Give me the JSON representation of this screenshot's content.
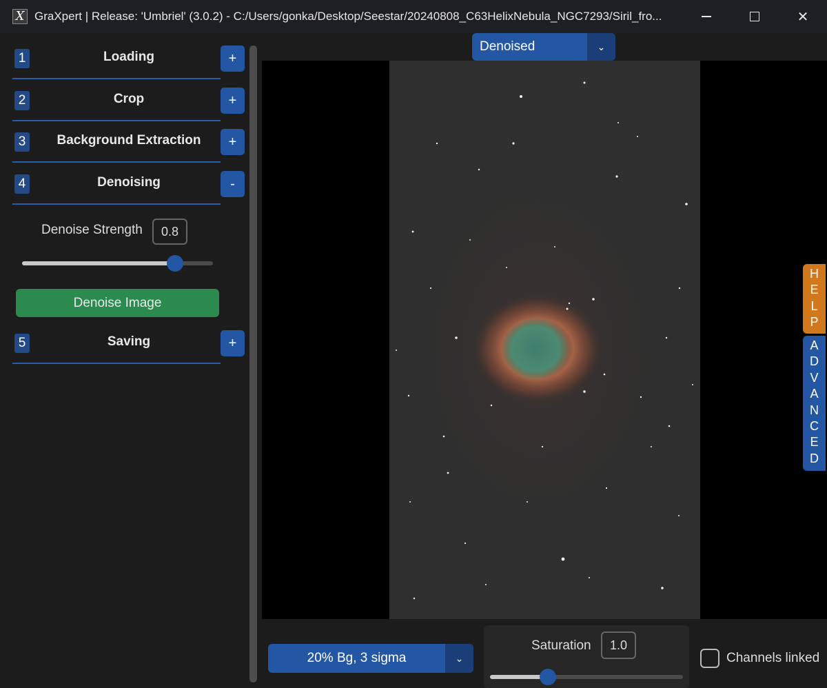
{
  "window": {
    "title": "GraXpert | Release: 'Umbriel' (3.0.2) - C:/Users/gonka/Desktop/Seestar/20240808_C63HelixNebula_NGC7293/Siril_fro...",
    "app_icon_glyph": "X",
    "minimize_icon": "minimize-icon",
    "maximize_icon": "maximize-icon",
    "close_glyph": "✕"
  },
  "sidebar": {
    "sections": [
      {
        "number": "1",
        "label": "Loading",
        "toggle": "+"
      },
      {
        "number": "2",
        "label": "Crop",
        "toggle": "+"
      },
      {
        "number": "3",
        "label": "Background Extraction",
        "toggle": "+"
      },
      {
        "number": "4",
        "label": "Denoising",
        "toggle": "-"
      },
      {
        "number": "5",
        "label": "Saving",
        "toggle": "+"
      }
    ],
    "denoise": {
      "strength_label": "Denoise Strength",
      "strength_value": "0.8",
      "strength_fraction": 0.8,
      "button_label": "Denoise Image"
    }
  },
  "main": {
    "view_select": {
      "value": "Denoised",
      "drop_glyph": "⌄"
    },
    "help_tab": "HELP",
    "advanced_tab": "ADVANCED"
  },
  "bottom": {
    "stretch_select": {
      "value": "20% Bg, 3 sigma",
      "drop_glyph": "⌄"
    },
    "saturation": {
      "label": "Saturation",
      "value": "1.0",
      "fraction": 0.3
    },
    "channels_linked": {
      "label": "Channels linked",
      "checked": false
    }
  },
  "colors": {
    "accent_blue": "#2357a3",
    "button_green": "#2b8a4d",
    "help_orange": "#d2781c"
  }
}
